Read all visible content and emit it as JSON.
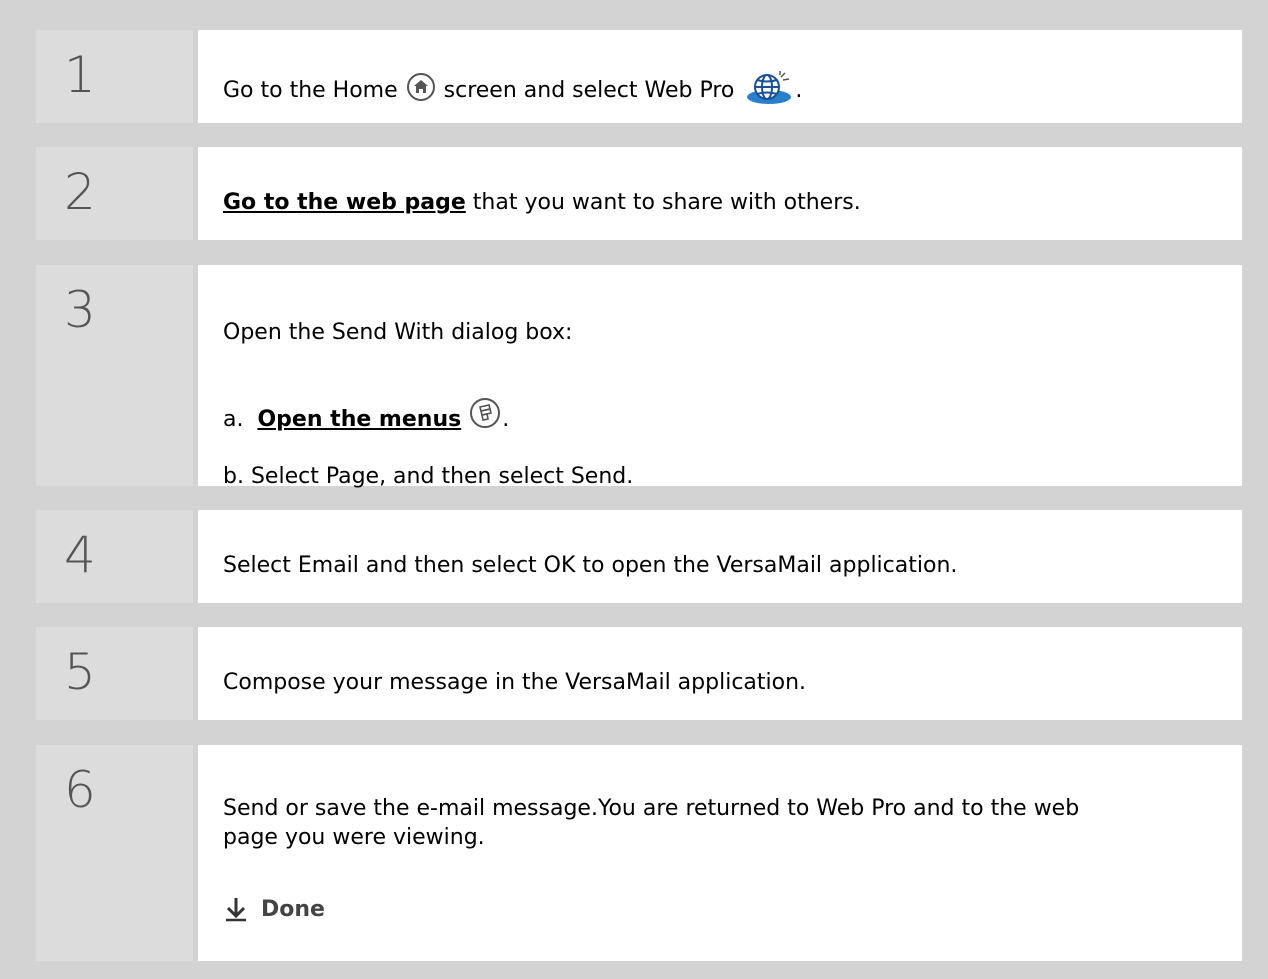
{
  "steps": [
    {
      "number": "1",
      "text_before": "Go to the Home",
      "text_middle": "screen and select Web Pro",
      "text_after": "."
    },
    {
      "number": "2",
      "link": "Go to the web page",
      "text_after": " that you want to share with others."
    },
    {
      "number": "3",
      "intro": "Open the Send With dialog box:",
      "sub_a_prefix": "a.",
      "sub_a_link": "Open the menus",
      "sub_a_after": ".",
      "sub_b": "b.  Select Page, and then select Send."
    },
    {
      "number": "4",
      "text": "Select Email and then select OK to open the VersaMail application."
    },
    {
      "number": "5",
      "text": "Compose your message in the VersaMail application."
    },
    {
      "number": "6",
      "line1": "Send or save the e-mail message.You are returned to Web Pro and to the web",
      "line2": "page you were viewing.",
      "done": "Done"
    }
  ],
  "icons": {
    "home": "home-icon",
    "web_pro": "web-pro-globe-icon",
    "menu": "menu-icon",
    "done_arrow": "down-arrow-icon"
  },
  "colors": {
    "background": "#d3d3d3",
    "number_cell": "#dcdcdc",
    "content_cell": "#ffffff",
    "number_text": "#555555"
  }
}
